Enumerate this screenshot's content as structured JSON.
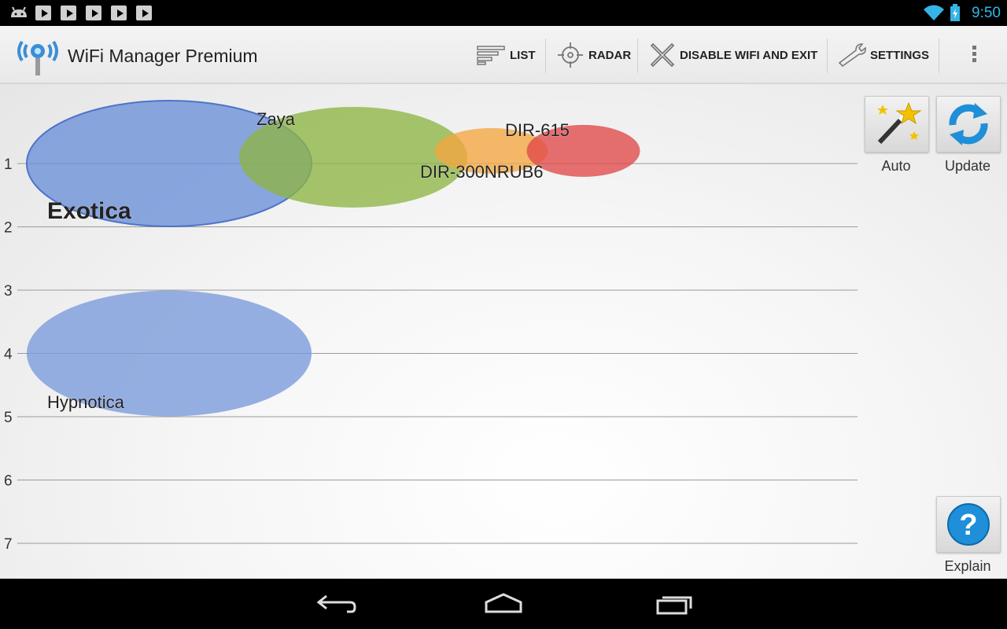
{
  "status_bar": {
    "time": "9:50",
    "icons": [
      "android-debug-icon",
      "play-store-icon",
      "play-store-icon",
      "play-store-icon",
      "play-store-icon",
      "play-store-icon",
      "wifi-signal-icon",
      "battery-charging-icon"
    ]
  },
  "action_bar": {
    "title": "WiFi Manager Premium",
    "logo": "wifi-manager-logo-icon",
    "actions": [
      {
        "label": "LIST",
        "icon": "list-icon"
      },
      {
        "label": "RADAR",
        "icon": "radar-icon"
      },
      {
        "label": "DISABLE WIFI AND EXIT",
        "icon": "close-icon"
      },
      {
        "label": "SETTINGS",
        "icon": "wrench-icon"
      }
    ],
    "overflow": "overflow-menu-icon"
  },
  "graph": {
    "y_ticks": [
      "1",
      "2",
      "3",
      "4",
      "5",
      "6",
      "7"
    ],
    "networks": [
      {
        "name": "Exotica",
        "channel": 1,
        "signal": 1.0,
        "color": "#6b8fd8",
        "bold": true
      },
      {
        "name": "Zaya",
        "channel": 5,
        "signal": 0.9,
        "color": "#8db544",
        "bold": false
      },
      {
        "name": "DIR-300NRUB6",
        "channel": 8,
        "signal": 0.8,
        "color": "#f3a640",
        "bold": false
      },
      {
        "name": "DIR-615",
        "channel": 10,
        "signal": 0.8,
        "color": "#e04848",
        "bold": false
      },
      {
        "name": "Hypnotica",
        "channel": 1,
        "signal": 4.0,
        "color": "#7a9adb",
        "bold": false
      }
    ]
  },
  "side_buttons": {
    "auto": {
      "label": "Auto",
      "icon": "magic-wand-icon"
    },
    "update": {
      "label": "Update",
      "icon": "refresh-icon"
    },
    "explain": {
      "label": "Explain",
      "icon": "help-icon"
    }
  },
  "nav_bar": {
    "back": "back-icon",
    "home": "home-icon",
    "recents": "recent-apps-icon"
  }
}
